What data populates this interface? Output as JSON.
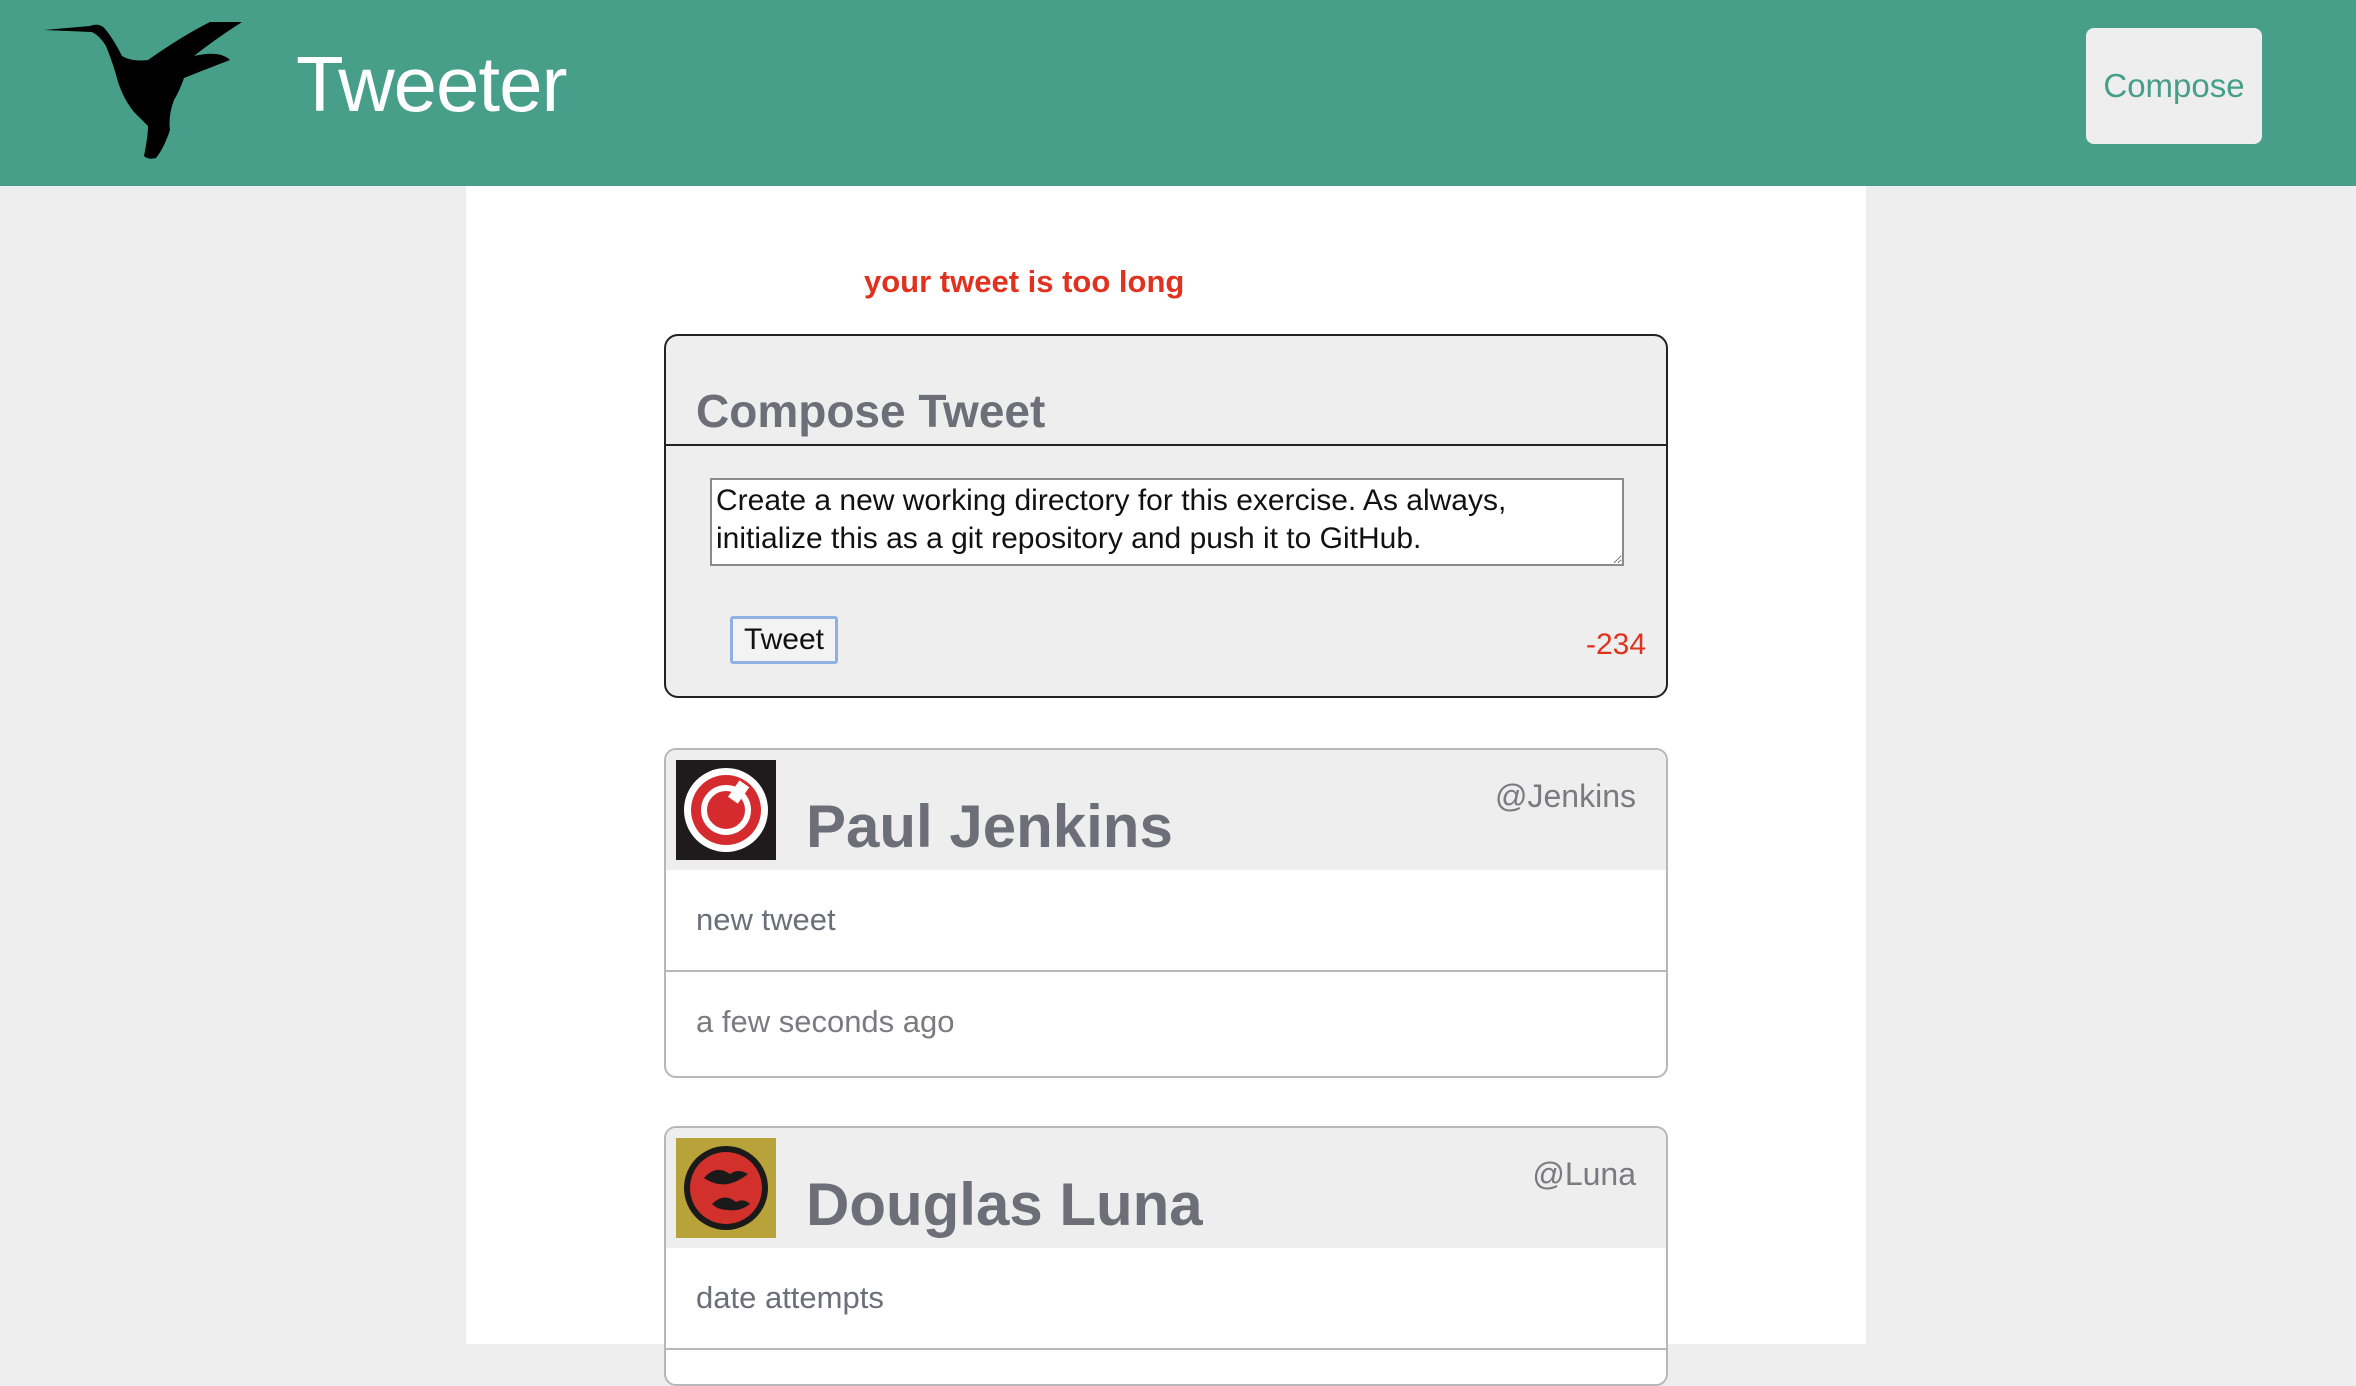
{
  "header": {
    "brand": "Tweeter",
    "compose_label": "Compose",
    "logo_icon": "hummingbird-icon",
    "colors": {
      "bar": "#479f8a",
      "text": "#ffffff"
    }
  },
  "compose": {
    "error": "your tweet is too long",
    "title": "Compose Tweet",
    "text": "Create a new working directory for this exercise. As always, initialize this as a git repository and push it to GitHub.",
    "submit_label": "Tweet",
    "counter": "-234",
    "error_color": "#e0321f"
  },
  "tweets": [
    {
      "name": "Paul Jenkins",
      "handle": "@Jenkins",
      "content": "new tweet",
      "time": "a few seconds ago",
      "avatar_icon": "red-circle-avatar-icon"
    },
    {
      "name": "Douglas Luna",
      "handle": "@Luna",
      "content": "date attempts",
      "time": "",
      "avatar_icon": "birds-circle-avatar-icon"
    }
  ]
}
